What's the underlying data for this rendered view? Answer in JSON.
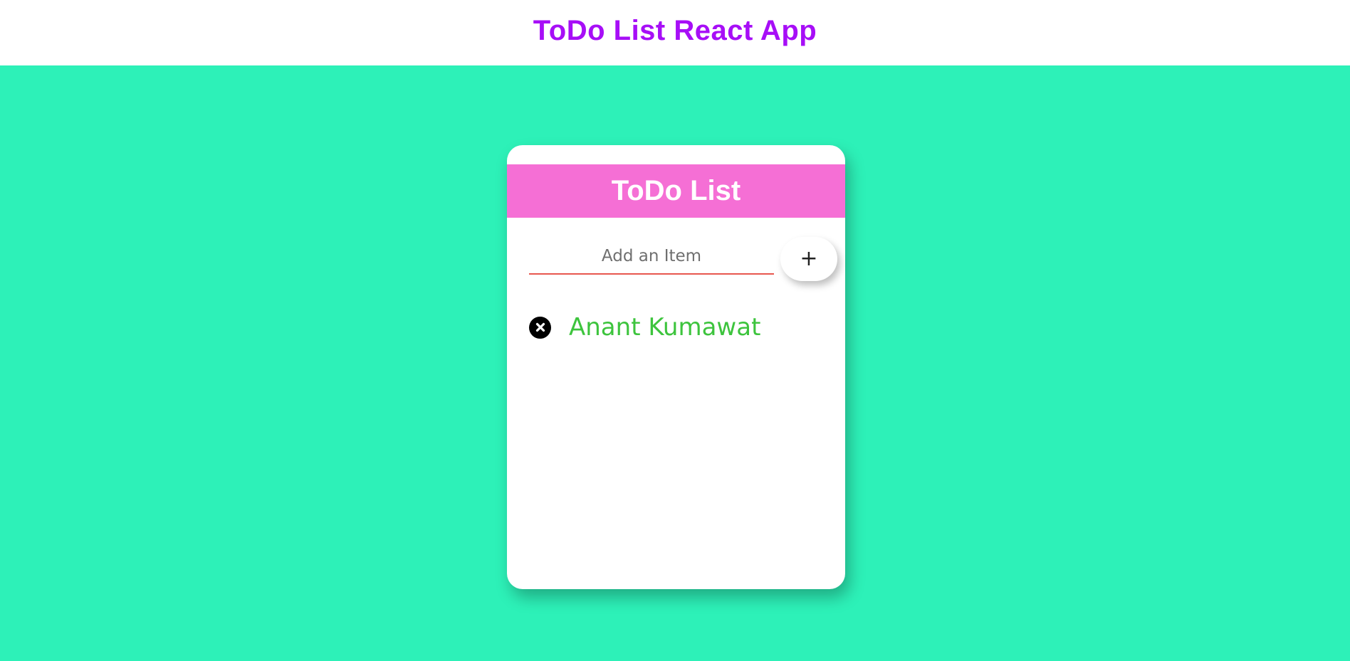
{
  "header": {
    "title": "ToDo List React App"
  },
  "card": {
    "title": "ToDo List",
    "input": {
      "placeholder": "Add an Item",
      "value": ""
    },
    "add_button": {
      "label": "+"
    },
    "items": [
      {
        "text": "Anant Kumawat",
        "delete_icon": "close-circle-icon"
      }
    ]
  },
  "colors": {
    "page_background": "#2df1b8",
    "title_color": "#a70ef7",
    "card_header": "#f56fd5",
    "item_text": "#3dc43d",
    "input_underline": "#e8574e"
  }
}
